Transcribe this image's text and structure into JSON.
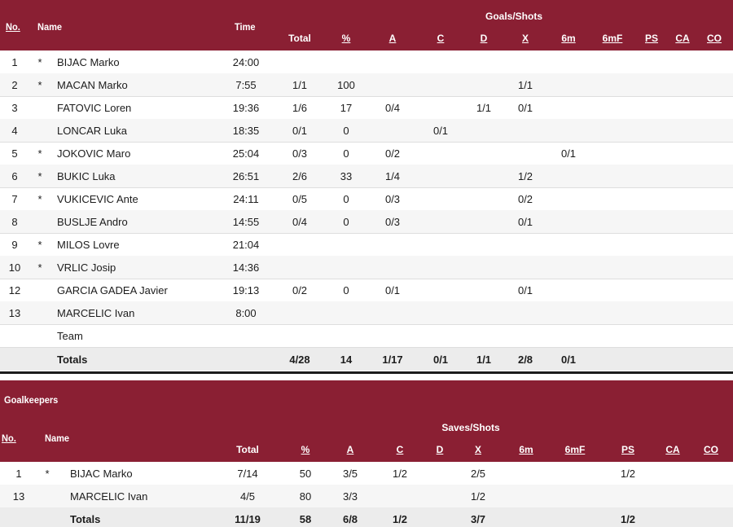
{
  "players": {
    "header": {
      "no": "No.",
      "name": "Name",
      "time": "Time",
      "group": "Goals/Shots",
      "cols": [
        "Total",
        "%",
        "A",
        "C",
        "D",
        "X",
        "6m",
        "6mF",
        "PS",
        "CA",
        "CO"
      ]
    },
    "rows": [
      {
        "no": "1",
        "star": "*",
        "name": "BIJAC Marko",
        "time": "24:00",
        "total": "",
        "pct": "",
        "a": "",
        "c": "",
        "d": "",
        "x": "",
        "m6": "",
        "m6f": ""
      },
      {
        "no": "2",
        "star": "*",
        "name": "MACAN Marko",
        "time": "7:55",
        "total": "1/1",
        "pct": "100",
        "a": "",
        "c": "",
        "d": "",
        "x": "1/1",
        "m6": "",
        "m6f": ""
      },
      {
        "no": "3",
        "star": "",
        "name": "FATOVIC Loren",
        "time": "19:36",
        "total": "1/6",
        "pct": "17",
        "a": "0/4",
        "c": "",
        "d": "1/1",
        "x": "0/1",
        "m6": "",
        "m6f": ""
      },
      {
        "no": "4",
        "star": "",
        "name": "LONCAR Luka",
        "time": "18:35",
        "total": "0/1",
        "pct": "0",
        "a": "",
        "c": "0/1",
        "d": "",
        "x": "",
        "m6": "",
        "m6f": ""
      },
      {
        "no": "5",
        "star": "*",
        "name": "JOKOVIC Maro",
        "time": "25:04",
        "total": "0/3",
        "pct": "0",
        "a": "0/2",
        "c": "",
        "d": "",
        "x": "",
        "m6": "0/1",
        "m6f": ""
      },
      {
        "no": "6",
        "star": "*",
        "name": "BUKIC Luka",
        "time": "26:51",
        "total": "2/6",
        "pct": "33",
        "a": "1/4",
        "c": "",
        "d": "",
        "x": "1/2",
        "m6": "",
        "m6f": ""
      },
      {
        "no": "7",
        "star": "*",
        "name": "VUKICEVIC Ante",
        "time": "24:11",
        "total": "0/5",
        "pct": "0",
        "a": "0/3",
        "c": "",
        "d": "",
        "x": "0/2",
        "m6": "",
        "m6f": ""
      },
      {
        "no": "8",
        "star": "",
        "name": "BUSLJE Andro",
        "time": "14:55",
        "total": "0/4",
        "pct": "0",
        "a": "0/3",
        "c": "",
        "d": "",
        "x": "0/1",
        "m6": "",
        "m6f": ""
      },
      {
        "no": "9",
        "star": "*",
        "name": "MILOS Lovre",
        "time": "21:04",
        "total": "",
        "pct": "",
        "a": "",
        "c": "",
        "d": "",
        "x": "",
        "m6": "",
        "m6f": ""
      },
      {
        "no": "10",
        "star": "*",
        "name": "VRLIC Josip",
        "time": "14:36",
        "total": "",
        "pct": "",
        "a": "",
        "c": "",
        "d": "",
        "x": "",
        "m6": "",
        "m6f": ""
      },
      {
        "no": "12",
        "star": "",
        "name": "GARCIA GADEA Javier",
        "time": "19:13",
        "total": "0/2",
        "pct": "0",
        "a": "0/1",
        "c": "",
        "d": "",
        "x": "0/1",
        "m6": "",
        "m6f": ""
      },
      {
        "no": "13",
        "star": "",
        "name": "MARCELIC Ivan",
        "time": "8:00",
        "total": "",
        "pct": "",
        "a": "",
        "c": "",
        "d": "",
        "x": "",
        "m6": "",
        "m6f": ""
      },
      {
        "no": "",
        "star": "",
        "name": "Team",
        "time": "",
        "total": "",
        "pct": "",
        "a": "",
        "c": "",
        "d": "",
        "x": "",
        "m6": "",
        "m6f": ""
      }
    ],
    "totals": {
      "label": "Totals",
      "total": "4/28",
      "pct": "14",
      "a": "1/17",
      "c": "0/1",
      "d": "1/1",
      "x": "2/8",
      "m6": "0/1"
    }
  },
  "goalkeepers": {
    "title": "Goalkeepers",
    "header": {
      "no": "No.",
      "name": "Name",
      "group": "Saves/Shots",
      "cols": [
        "Total",
        "%",
        "A",
        "C",
        "D",
        "X",
        "6m",
        "6mF",
        "PS",
        "CA",
        "CO"
      ]
    },
    "rows": [
      {
        "no": "1",
        "star": "*",
        "name": "BIJAC Marko",
        "total": "7/14",
        "pct": "50",
        "a": "3/5",
        "c": "1/2",
        "x": "2/5",
        "ps": "1/2"
      },
      {
        "no": "13",
        "star": "",
        "name": "MARCELIC Ivan",
        "total": "4/5",
        "pct": "80",
        "a": "3/3",
        "c": "",
        "x": "1/2",
        "ps": ""
      }
    ],
    "totals": {
      "label": "Totals",
      "total": "11/19",
      "pct": "58",
      "a": "6/8",
      "c": "1/2",
      "x": "3/7",
      "ps": "1/2"
    }
  },
  "colors": {
    "header_bg": "#8a1f33",
    "header_text": "#ffffff",
    "alt_row": "#f6f6f6",
    "totals_row": "#ececec"
  }
}
